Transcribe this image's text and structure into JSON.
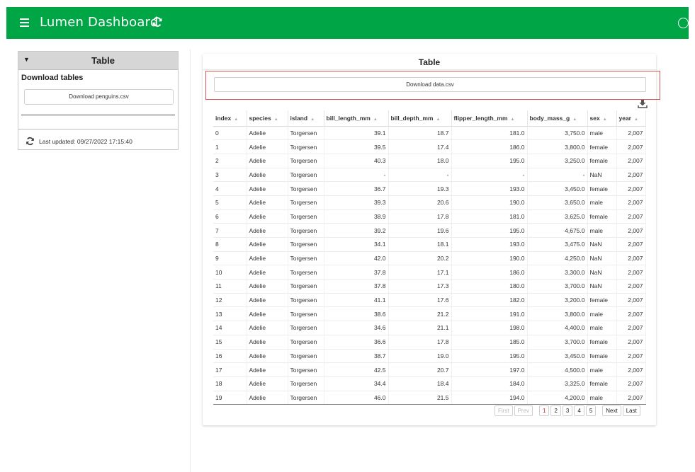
{
  "header": {
    "title": "Lumen Dashboard"
  },
  "sidebar": {
    "card_title": "Table",
    "download_section_title": "Download tables",
    "download_penguins_label": "Download penguins.csv",
    "last_updated": "Last updated: 09/27/2022 17:15:40"
  },
  "main": {
    "title": "Table",
    "download_button_label": "Download data.csv",
    "columns": [
      "index",
      "species",
      "island",
      "bill_length_mm",
      "bill_depth_mm",
      "flipper_length_mm",
      "body_mass_g",
      "sex",
      "year"
    ],
    "rows": [
      [
        "0",
        "Adelie",
        "Torgersen",
        "39.1",
        "18.7",
        "181.0",
        "3,750.0",
        "male",
        "2,007"
      ],
      [
        "1",
        "Adelie",
        "Torgersen",
        "39.5",
        "17.4",
        "186.0",
        "3,800.0",
        "female",
        "2,007"
      ],
      [
        "2",
        "Adelie",
        "Torgersen",
        "40.3",
        "18.0",
        "195.0",
        "3,250.0",
        "female",
        "2,007"
      ],
      [
        "3",
        "Adelie",
        "Torgersen",
        "-",
        "-",
        "-",
        "-",
        "NaN",
        "2,007"
      ],
      [
        "4",
        "Adelie",
        "Torgersen",
        "36.7",
        "19.3",
        "193.0",
        "3,450.0",
        "female",
        "2,007"
      ],
      [
        "5",
        "Adelie",
        "Torgersen",
        "39.3",
        "20.6",
        "190.0",
        "3,650.0",
        "male",
        "2,007"
      ],
      [
        "6",
        "Adelie",
        "Torgersen",
        "38.9",
        "17.8",
        "181.0",
        "3,625.0",
        "female",
        "2,007"
      ],
      [
        "7",
        "Adelie",
        "Torgersen",
        "39.2",
        "19.6",
        "195.0",
        "4,675.0",
        "male",
        "2,007"
      ],
      [
        "8",
        "Adelie",
        "Torgersen",
        "34.1",
        "18.1",
        "193.0",
        "3,475.0",
        "NaN",
        "2,007"
      ],
      [
        "9",
        "Adelie",
        "Torgersen",
        "42.0",
        "20.2",
        "190.0",
        "4,250.0",
        "NaN",
        "2,007"
      ],
      [
        "10",
        "Adelie",
        "Torgersen",
        "37.8",
        "17.1",
        "186.0",
        "3,300.0",
        "NaN",
        "2,007"
      ],
      [
        "11",
        "Adelie",
        "Torgersen",
        "37.8",
        "17.3",
        "180.0",
        "3,700.0",
        "NaN",
        "2,007"
      ],
      [
        "12",
        "Adelie",
        "Torgersen",
        "41.1",
        "17.6",
        "182.0",
        "3,200.0",
        "female",
        "2,007"
      ],
      [
        "13",
        "Adelie",
        "Torgersen",
        "38.6",
        "21.2",
        "191.0",
        "3,800.0",
        "male",
        "2,007"
      ],
      [
        "14",
        "Adelie",
        "Torgersen",
        "34.6",
        "21.1",
        "198.0",
        "4,400.0",
        "male",
        "2,007"
      ],
      [
        "15",
        "Adelie",
        "Torgersen",
        "36.6",
        "17.8",
        "185.0",
        "3,700.0",
        "female",
        "2,007"
      ],
      [
        "16",
        "Adelie",
        "Torgersen",
        "38.7",
        "19.0",
        "195.0",
        "3,450.0",
        "female",
        "2,007"
      ],
      [
        "17",
        "Adelie",
        "Torgersen",
        "42.5",
        "20.7",
        "197.0",
        "4,500.0",
        "male",
        "2,007"
      ],
      [
        "18",
        "Adelie",
        "Torgersen",
        "34.4",
        "18.4",
        "184.0",
        "3,325.0",
        "female",
        "2,007"
      ],
      [
        "19",
        "Adelie",
        "Torgersen",
        "46.0",
        "21.5",
        "194.0",
        "4,200.0",
        "male",
        "2,007"
      ]
    ],
    "pagination": {
      "first": "First",
      "prev": "Prev",
      "pages": [
        "1",
        "2",
        "3",
        "4",
        "5"
      ],
      "active_page": "1",
      "next": "Next",
      "last": "Last"
    }
  },
  "colors": {
    "header_bg": "#00a645",
    "highlight_border": "#d9534f",
    "active_page": "#c92424"
  },
  "icons": [
    "menu-icon",
    "refresh-icon",
    "status-circle-icon",
    "caret-down-icon",
    "download-icon",
    "sort-icon"
  ]
}
